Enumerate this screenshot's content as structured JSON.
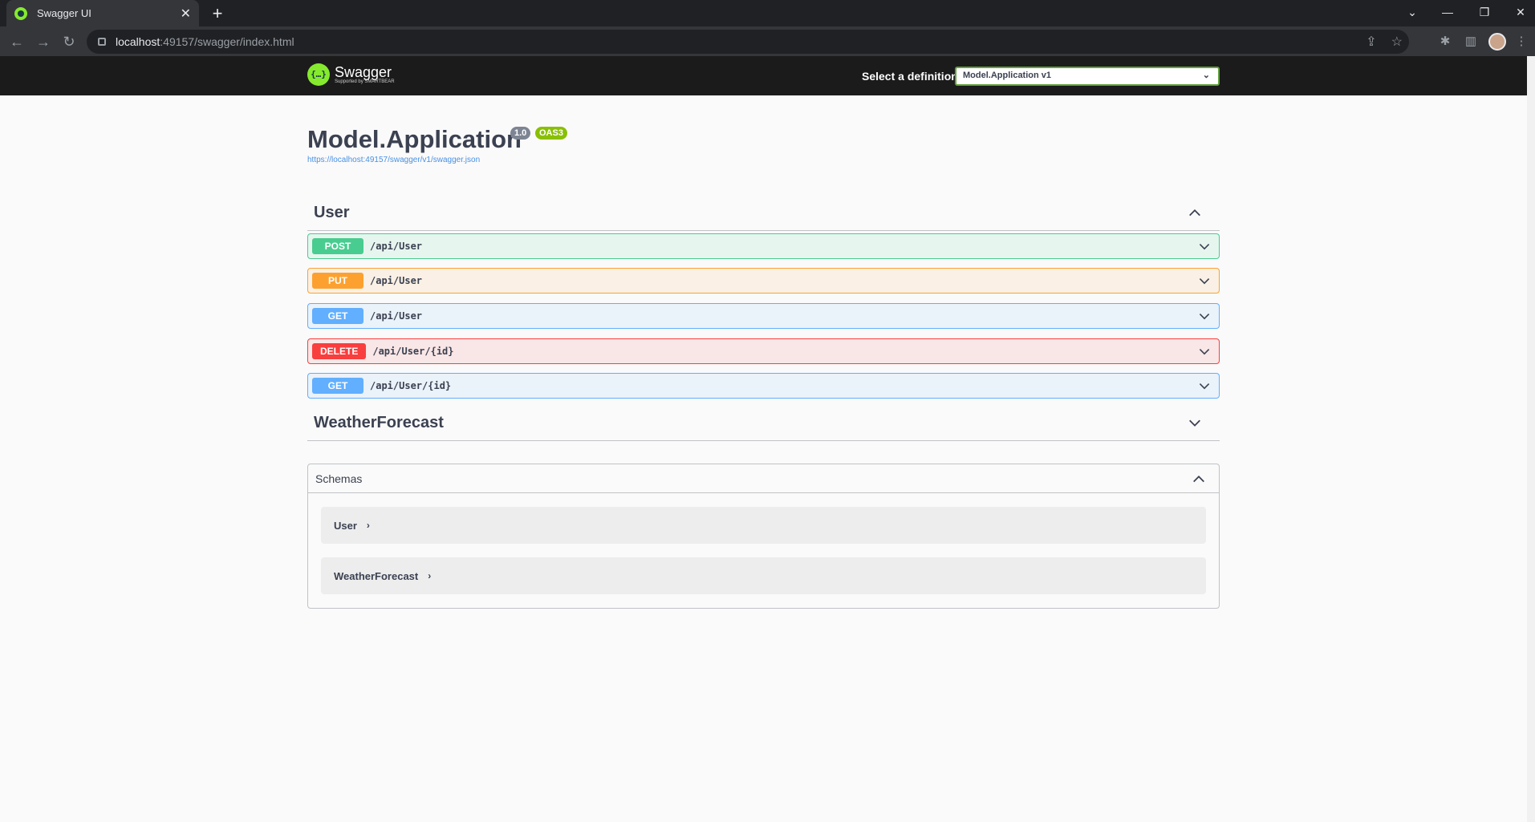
{
  "browser": {
    "tab_title": "Swagger UI",
    "tab_close": "✕",
    "new_tab": "+",
    "url_host": "localhost",
    "url_rest": ":49157/swagger/index.html"
  },
  "topbar": {
    "logo_glyph": "{…}",
    "logo_name": "Swagger",
    "logo_sub": "Supported by SMARTBEAR",
    "definition_label": "Select a definition",
    "definition_value": "Model.Application v1"
  },
  "info": {
    "title": "Model.Application",
    "version": "1.0",
    "oas": "OAS3",
    "spec_url": "https://localhost:49157/swagger/v1/swagger.json"
  },
  "tags": [
    {
      "name": "User",
      "expanded": true,
      "operations": [
        {
          "method": "POST",
          "path": "/api/User"
        },
        {
          "method": "PUT",
          "path": "/api/User"
        },
        {
          "method": "GET",
          "path": "/api/User"
        },
        {
          "method": "DELETE",
          "path": "/api/User/{id}"
        },
        {
          "method": "GET",
          "path": "/api/User/{id}"
        }
      ]
    },
    {
      "name": "WeatherForecast",
      "expanded": false
    }
  ],
  "schemas": {
    "title": "Schemas",
    "models": [
      "User",
      "WeatherForecast"
    ],
    "arrow": "›"
  },
  "colors": {
    "post": "#49cc90",
    "put": "#fca130",
    "get": "#61affe",
    "delete": "#f93e3e",
    "topbar": "#1b1b1b",
    "accent": "#85ea2d"
  }
}
